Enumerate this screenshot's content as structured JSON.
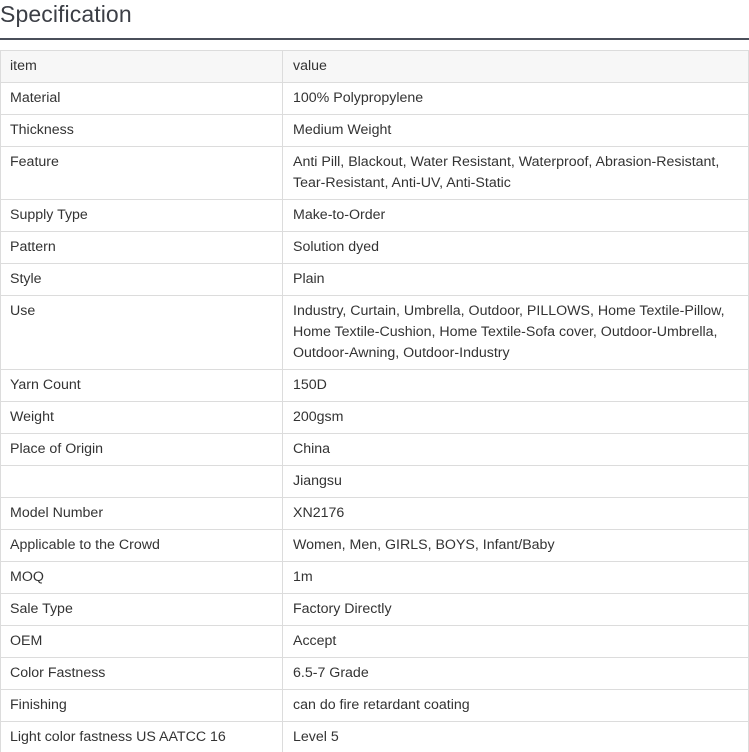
{
  "heading": {
    "title": "Specification"
  },
  "table": {
    "columns": [
      "item",
      "value"
    ],
    "rows": [
      {
        "item": "Material",
        "value": "100% Polypropylene"
      },
      {
        "item": "Thickness",
        "value": "Medium Weight"
      },
      {
        "item": "Feature",
        "value": "Anti Pill, Blackout, Water Resistant, Waterproof, Abrasion-Resistant, Tear-Resistant, Anti-UV, Anti-Static"
      },
      {
        "item": "Supply Type",
        "value": "Make-to-Order"
      },
      {
        "item": "Pattern",
        "value": "Solution dyed"
      },
      {
        "item": "Style",
        "value": "Plain"
      },
      {
        "item": "Use",
        "value": "Industry, Curtain, Umbrella, Outdoor, PILLOWS, Home Textile-Pillow, Home Textile-Cushion, Home Textile-Sofa cover, Outdoor-Umbrella, Outdoor-Awning, Outdoor-Industry"
      },
      {
        "item": "Yarn Count",
        "value": "150D"
      },
      {
        "item": "Weight",
        "value": "200gsm"
      },
      {
        "item": "Place of Origin",
        "value": "China"
      },
      {
        "item": "",
        "value": "Jiangsu"
      },
      {
        "item": "Model Number",
        "value": "XN2176"
      },
      {
        "item": "Applicable to the Crowd",
        "value": "Women, Men, GIRLS, BOYS, Infant/Baby"
      },
      {
        "item": "MOQ",
        "value": "1m"
      },
      {
        "item": "Sale Type",
        "value": "Factory Directly"
      },
      {
        "item": "OEM",
        "value": "Accept"
      },
      {
        "item": "Color Fastness",
        "value": "6.5-7 Grade"
      },
      {
        "item": "Finishing",
        "value": "can do fire retardant coating"
      },
      {
        "item": "Light color fastness US AATCC 16",
        "value": "Level 5"
      }
    ]
  }
}
